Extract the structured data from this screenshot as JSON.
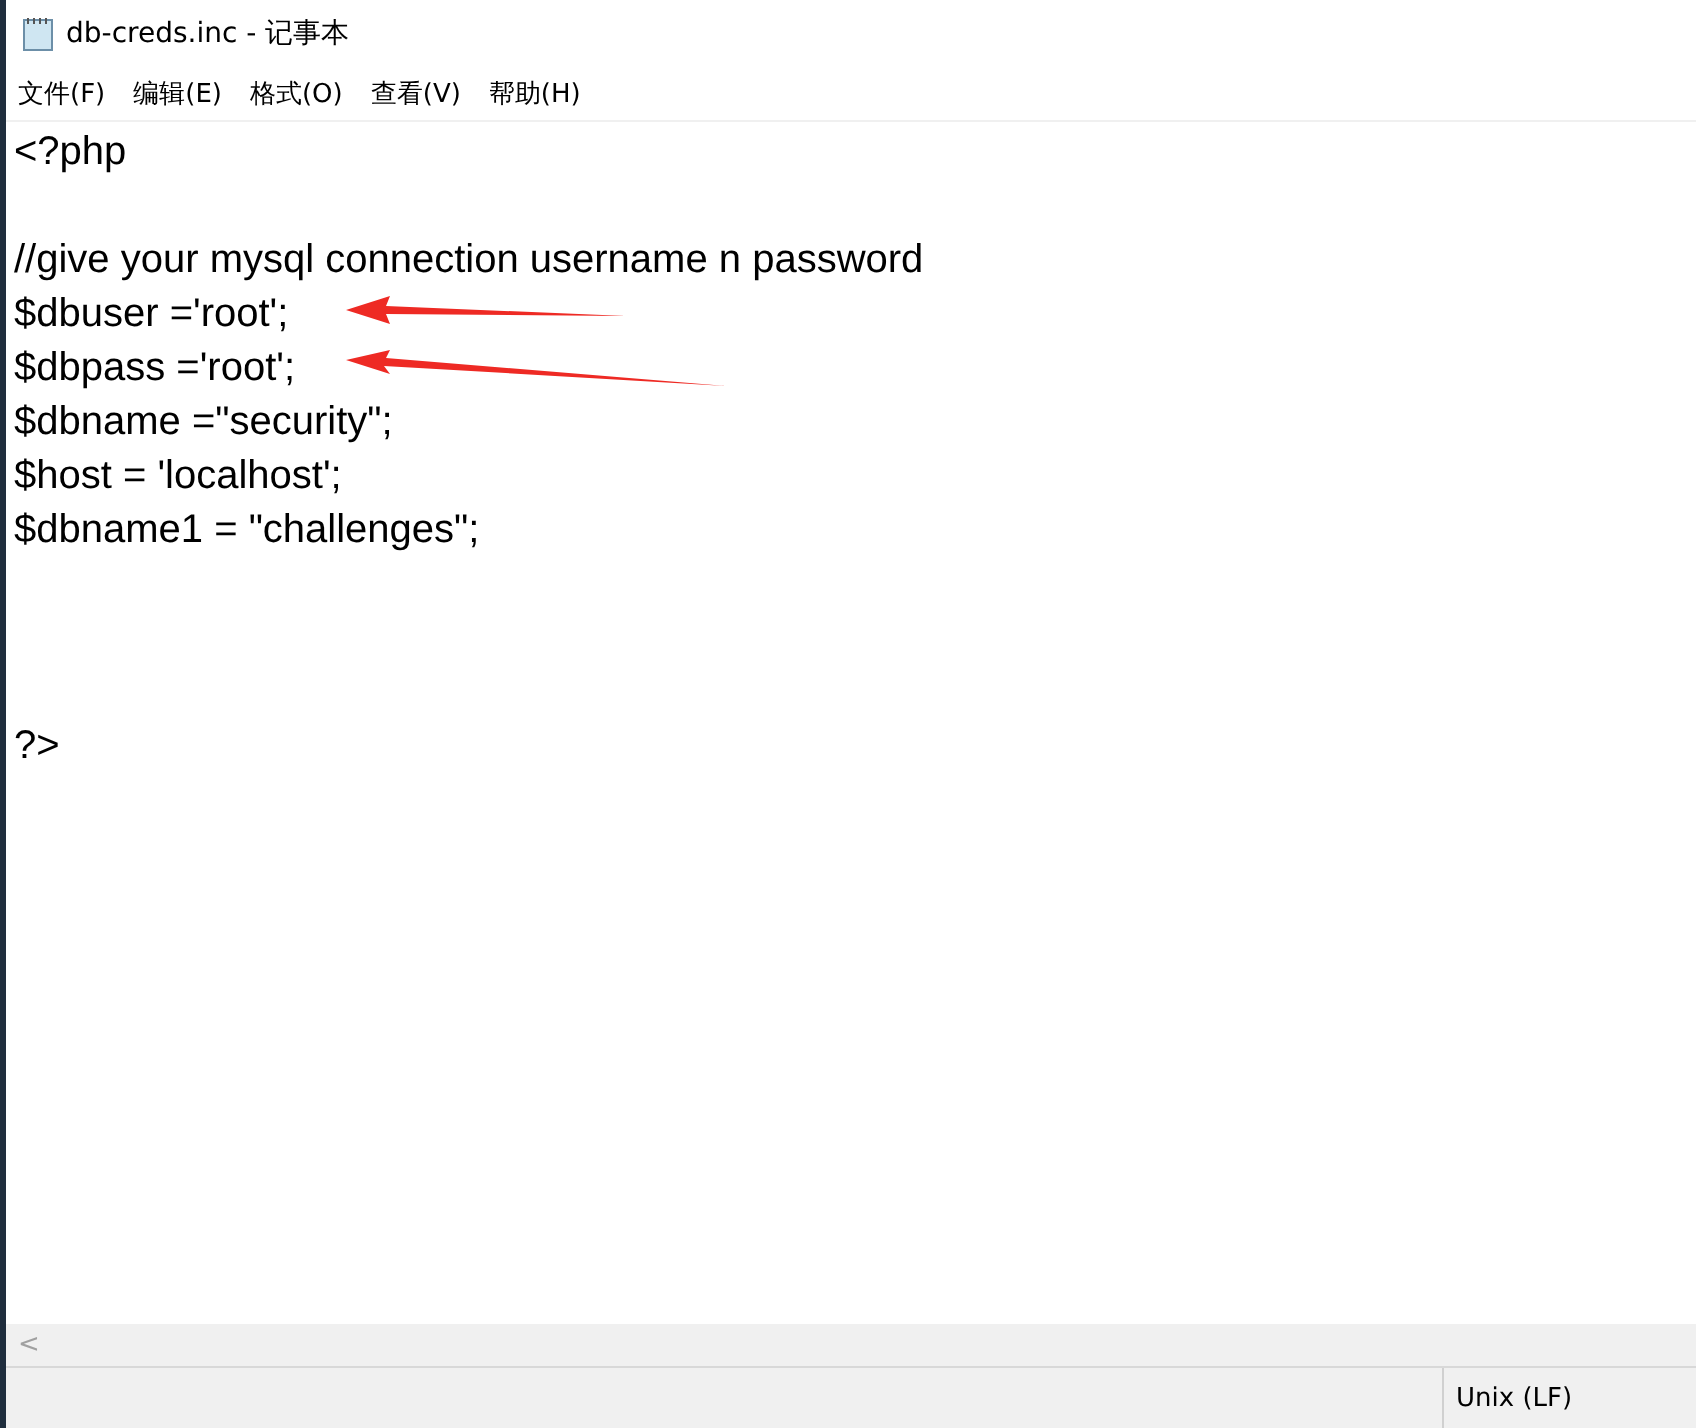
{
  "window": {
    "title": "db-creds.inc - 记事本"
  },
  "menu": [
    "文件(F)",
    "编辑(E)",
    "格式(O)",
    "查看(V)",
    "帮助(H)"
  ],
  "editor": {
    "lines": [
      {
        "text": "<?php",
        "arrow": false
      },
      {
        "arrow": false
      },
      {
        "text": "//give your mysql connection username n password",
        "arrow": false
      },
      {
        "text": "$dbuser ='root';",
        "arrow": true
      },
      {
        "text": "$dbpass ='root';",
        "arrow": true
      },
      {
        "text": "$dbname =\"security\";",
        "arrow": false
      },
      {
        "text": "$host = 'localhost';",
        "arrow": false
      },
      {
        "text": "$dbname1 = \"challenges\";",
        "arrow": false
      },
      {
        "arrow": false
      },
      {
        "arrow": false
      },
      {
        "arrow": false
      },
      {
        "text": "?>",
        "arrow": false
      }
    ]
  },
  "scrollbar": {
    "left_arrow": "<"
  },
  "status_bar": {
    "line_ending": "Unix (LF)"
  }
}
